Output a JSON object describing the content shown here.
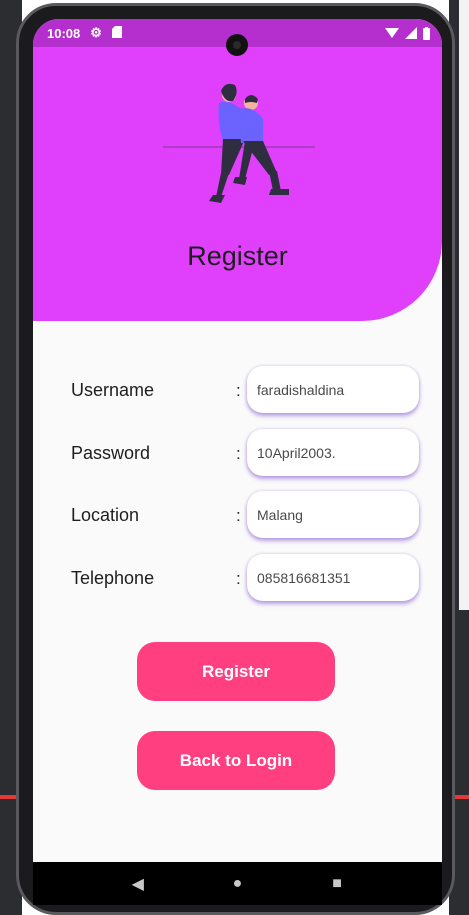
{
  "status_bar": {
    "time": "10:08"
  },
  "header": {
    "title": "Register"
  },
  "form": {
    "separator": ":",
    "fields": [
      {
        "label": "Username",
        "value": "faradishaldina"
      },
      {
        "label": "Password",
        "value": "10April2003."
      },
      {
        "label": "Location",
        "value": "Malang"
      },
      {
        "label": "Telephone",
        "value": "085816681351"
      }
    ]
  },
  "buttons": {
    "register": "Register",
    "back_to_login": "Back to Login"
  },
  "colors": {
    "header": "#e040fb",
    "status_bar": "#b42fcd",
    "button": "#ff3f7f",
    "illustration_shirt": "#6c63ff",
    "illustration_pants": "#2f2e41"
  },
  "icons": {
    "status_left": [
      "gear-icon",
      "sd-card-icon"
    ],
    "status_right": [
      "wifi-icon",
      "signal-icon",
      "battery-icon"
    ],
    "nav": [
      "back-icon",
      "home-icon",
      "recents-icon"
    ]
  }
}
